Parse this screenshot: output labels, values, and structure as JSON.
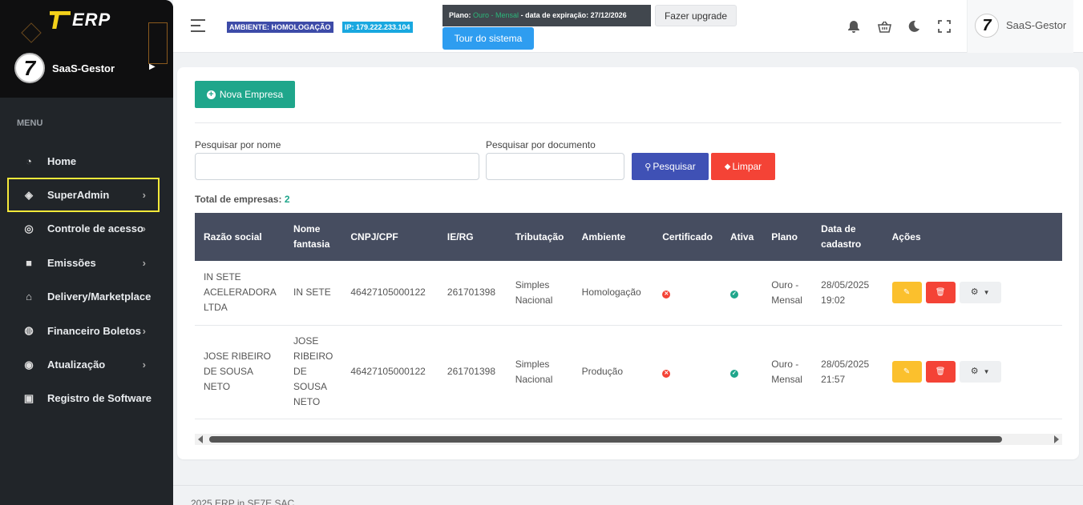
{
  "app": {
    "brand": "ERP",
    "user": "SaaS-Gestor",
    "avatar_glyph": "7"
  },
  "sidebar": {
    "menu_title": "MENU",
    "items": [
      {
        "label": "Home",
        "icon": "dashboard-icon",
        "glyph": "◔",
        "chevron": false
      },
      {
        "label": "SuperAdmin",
        "icon": "layers-icon",
        "glyph": "◈",
        "chevron": true,
        "active": true
      },
      {
        "label": "Controle de acesso",
        "icon": "access-icon",
        "glyph": "◎",
        "chevron": true
      },
      {
        "label": "Emissões",
        "icon": "document-icon",
        "glyph": "■",
        "chevron": true
      },
      {
        "label": "Delivery/Marketplace",
        "icon": "store-icon",
        "glyph": "⌂",
        "chevron": false
      },
      {
        "label": "Financeiro Boletos",
        "icon": "coins-icon",
        "glyph": "◍",
        "chevron": true
      },
      {
        "label": "Atualização",
        "icon": "update-icon",
        "glyph": "◉",
        "chevron": true
      },
      {
        "label": "Registro de Software",
        "icon": "bookmark-icon",
        "glyph": "▣",
        "chevron": false
      }
    ]
  },
  "topbar": {
    "env_badge": "AMBIENTE: HOMOLOGAÇÃO",
    "ip_badge": "IP: 179.222.233.104",
    "plan_prefix": "Plano:",
    "plan_name": "Ouro - Mensal",
    "plan_suffix": "- data de expiração: 27/12/2026",
    "upgrade_label": "Fazer upgrade",
    "tour_label": "Tour do sistema",
    "plan_color": "#2bb67a"
  },
  "main": {
    "new_company_label": "Nova Empresa",
    "search_name_label": "Pesquisar por nome",
    "search_doc_label": "Pesquisar por documento",
    "search_name_value": "",
    "search_doc_value": "",
    "search_button": "Pesquisar",
    "clear_button": "Limpar",
    "total_label": "Total de empresas:",
    "total_value": "2"
  },
  "table": {
    "headers": [
      "Razão social",
      "Nome fantasia",
      "CNPJ/CPF",
      "IE/RG",
      "Tributação",
      "Ambiente",
      "Certificado",
      "Ativa",
      "Plano",
      "Data de cadastro",
      "Ações"
    ],
    "rows": [
      {
        "razao": "IN SETE ACELERADORA LTDA",
        "fantasia": "IN SETE",
        "cnpj": "46427105000122",
        "ie": "261701398",
        "tributacao": "Simples Nacional",
        "ambiente": "Homologação",
        "certificado": "no",
        "ativa": "yes",
        "plano": "Ouro - Mensal",
        "data": "28/05/2025 19:02"
      },
      {
        "razao": "JOSE RIBEIRO DE SOUSA NETO",
        "fantasia": "JOSE RIBEIRO DE SOUSA NETO",
        "cnpj": "46427105000122",
        "ie": "261701398",
        "tributacao": "Simples Nacional",
        "ambiente": "Produção",
        "certificado": "no",
        "ativa": "yes",
        "plano": "Ouro - Mensal",
        "data": "28/05/2025 21:57"
      }
    ]
  },
  "footer": {
    "text": "2025 ERP in SE7E SAC"
  },
  "colors": {
    "sidebar": "#212529",
    "primary": "#1fa68b",
    "danger": "#f44336",
    "indigo": "#3f51b5",
    "warning": "#fbc02d",
    "table_header": "#464d60"
  }
}
